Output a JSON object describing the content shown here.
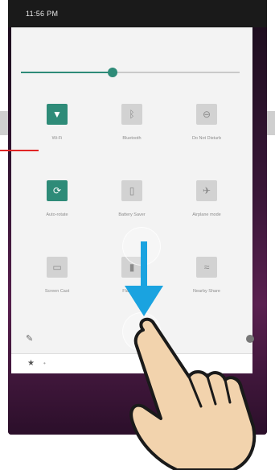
{
  "status_bar": {
    "time": "11:56 PM"
  },
  "brightness": {
    "level": 0.42
  },
  "tiles": [
    {
      "label": "Wi-Fi",
      "icon": "wifi-icon",
      "state": "on"
    },
    {
      "label": "Bluetooth",
      "icon": "bluetooth-icon",
      "state": "off"
    },
    {
      "label": "Do Not Disturb",
      "icon": "do-not-disturb-icon",
      "state": "off"
    },
    {
      "label": "Auto-rotate",
      "icon": "auto-rotate-icon",
      "state": "on"
    },
    {
      "label": "Battery Saver",
      "icon": "battery-icon",
      "state": "off"
    },
    {
      "label": "Airplane mode",
      "icon": "airplane-icon",
      "state": "off"
    },
    {
      "label": "Screen Cast",
      "icon": "cast-icon",
      "state": "off"
    },
    {
      "label": "Flashlight",
      "icon": "flashlight-icon",
      "state": "off"
    },
    {
      "label": "Nearby Share",
      "icon": "nearby-share-icon",
      "state": "off"
    }
  ],
  "colors": {
    "accent": "#2e8b78",
    "arrow": "#1aa3e0",
    "pointer": "#e02525"
  }
}
